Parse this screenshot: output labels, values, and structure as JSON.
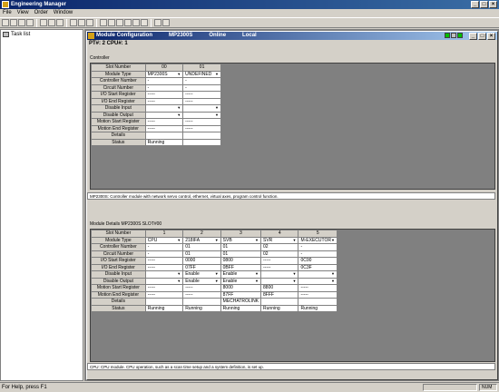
{
  "app": {
    "title": "Engineering Manager"
  },
  "menu": [
    "File",
    "View",
    "Order",
    "Window"
  ],
  "tree": {
    "root": "Task list"
  },
  "child": {
    "title": "Module Configuration",
    "model": "MP2300S",
    "mode": "Online",
    "scope": "Local"
  },
  "path": "PT#: 2 CPU#: 1",
  "controller": {
    "label": "Controller",
    "slots": [
      "00",
      "01"
    ],
    "rows": [
      {
        "label": "Slot Number",
        "values": [
          "00",
          "01"
        ],
        "header": true
      },
      {
        "label": "Module Type",
        "values": [
          "MP2300S",
          "UNDEFINED"
        ],
        "dropdown": [
          true,
          true
        ]
      },
      {
        "label": "Controller Number",
        "values": [
          "-",
          "-"
        ]
      },
      {
        "label": "Circuit Number",
        "values": [
          "-",
          "-"
        ]
      },
      {
        "label": "I/O Start Register",
        "values": [
          "-----",
          "-----"
        ]
      },
      {
        "label": "I/O End Register",
        "values": [
          "-----",
          "-----"
        ]
      },
      {
        "label": "Disable Input",
        "values": [
          "",
          ""
        ],
        "dropdown": [
          true,
          true
        ]
      },
      {
        "label": "Disable Output",
        "values": [
          "",
          ""
        ],
        "dropdown": [
          true,
          true
        ]
      },
      {
        "label": "Motion Start Register",
        "values": [
          "-----",
          "-----"
        ]
      },
      {
        "label": "Motion End Register",
        "values": [
          "-----",
          "-----"
        ]
      },
      {
        "label": "Details",
        "values": [
          "",
          ""
        ]
      },
      {
        "label": "Status",
        "values": [
          "Running",
          ""
        ]
      }
    ],
    "description": "MP2300S: Controller module with network servo control, ethernet, virtual axes, program control function."
  },
  "details": {
    "label": "Module Details  MP2300S  SLOT#00",
    "rows": [
      {
        "label": "Slot Number",
        "values": [
          "1",
          "2",
          "3",
          "4",
          "5"
        ],
        "header": true
      },
      {
        "label": "Module Type",
        "values": [
          "CPU",
          "218IFA",
          "SVB",
          "SVR",
          "M-EXECUTOR"
        ],
        "dropdown": [
          true,
          true,
          true,
          true,
          true
        ]
      },
      {
        "label": "Controller Number",
        "values": [
          "-",
          "01",
          "01",
          "02",
          "-"
        ]
      },
      {
        "label": "Circuit Number",
        "values": [
          "-",
          "01",
          "01",
          "02",
          "-"
        ]
      },
      {
        "label": "I/O Start Register",
        "values": [
          "-----",
          "0000",
          "0800",
          "-----",
          "0C00"
        ]
      },
      {
        "label": "I/O End Register",
        "values": [
          "-----",
          "07FF",
          "0BFF",
          "-----",
          "0C3F"
        ]
      },
      {
        "label": "Disable Input",
        "values": [
          "",
          "Enable",
          "Enable",
          "",
          ""
        ],
        "dropdown": [
          true,
          true,
          true,
          true,
          true
        ]
      },
      {
        "label": "Disable Output",
        "values": [
          "",
          "Enable",
          "Enable",
          "",
          ""
        ],
        "dropdown": [
          true,
          true,
          true,
          true,
          true
        ]
      },
      {
        "label": "Motion Start Register",
        "values": [
          "-----",
          "-----",
          "8000",
          "8800",
          "-----"
        ]
      },
      {
        "label": "Motion End Register",
        "values": [
          "-----",
          "-----",
          "87FF",
          "8FFF",
          "-----"
        ]
      },
      {
        "label": "Details",
        "values": [
          "",
          "",
          "MECHATROLINK",
          "",
          ""
        ]
      },
      {
        "label": "Status",
        "values": [
          "Running",
          "Running",
          "Running",
          "Running",
          "Running"
        ]
      }
    ],
    "description": "CPU: CPU module. CPU operation, such as a scan time setup and a system definition, is set up."
  },
  "statusbar": {
    "help": "For Help, press F1",
    "mode": "NUM"
  }
}
